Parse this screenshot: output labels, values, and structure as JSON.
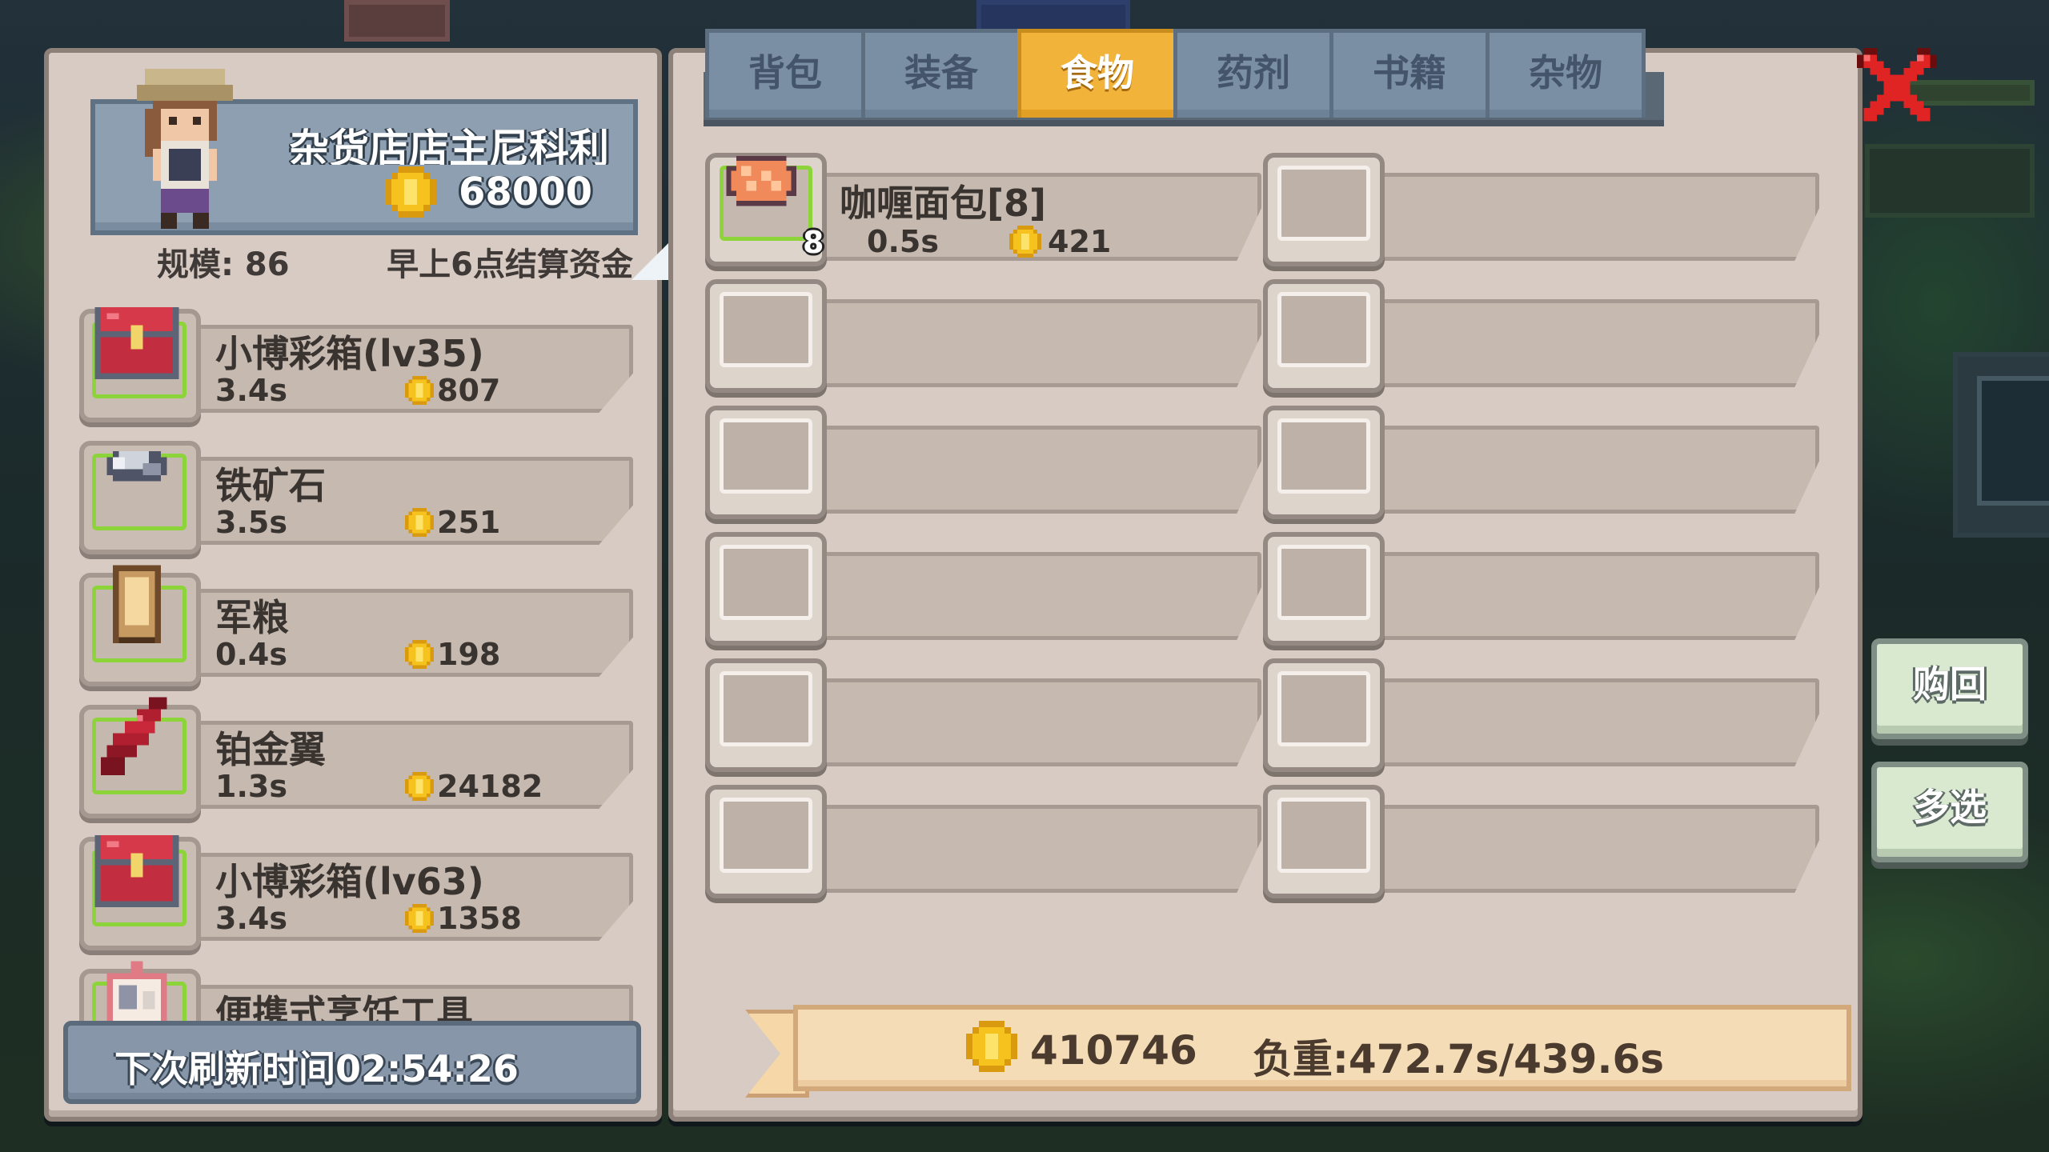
{
  "owner": {
    "name": "杂货店店主尼科利",
    "gold": "68000"
  },
  "shop_info": {
    "scale": "规模: 86",
    "settle": "早上6点结算资金"
  },
  "shop_items": [
    {
      "name": "小博彩箱(lv35)",
      "time": "3.4s",
      "price": "807",
      "icon": "treasure-chest-icon"
    },
    {
      "name": "铁矿石",
      "time": "3.5s",
      "price": "251",
      "icon": "iron-ore-icon"
    },
    {
      "name": "军粮",
      "time": "0.4s",
      "price": "198",
      "icon": "ration-icon"
    },
    {
      "name": "铂金翼",
      "time": "1.3s",
      "price": "24182",
      "icon": "red-wing-icon"
    },
    {
      "name": "小博彩箱(lv63)",
      "time": "3.4s",
      "price": "1358",
      "icon": "treasure-chest-icon"
    },
    {
      "name": "便携式烹饪工具",
      "time": "",
      "price": "",
      "icon": "cooking-tool-icon"
    }
  ],
  "refresh": "下次刷新时间02:54:26",
  "tabs": [
    {
      "label": "背包",
      "active": false
    },
    {
      "label": "装备",
      "active": false
    },
    {
      "label": "食物",
      "active": true
    },
    {
      "label": "药剂",
      "active": false
    },
    {
      "label": "书籍",
      "active": false
    },
    {
      "label": "杂物",
      "active": false
    }
  ],
  "inventory": {
    "filled": {
      "name": "咖喱面包[8]",
      "count": "8",
      "time": "0.5s",
      "price": "421",
      "icon": "curry-bread-icon"
    },
    "empty_slots": 11
  },
  "status": {
    "gold": "410746",
    "weight": "负重:472.7s/439.6s"
  },
  "buttons": {
    "buyback": "购回",
    "multi_select": "多选"
  },
  "colors": {
    "tab_active": "#f2b33b",
    "tab_inactive": "#7b8fa4",
    "slot_highlight": "#8dd33a",
    "close": "#e02424",
    "coin": "#f6c21d"
  }
}
